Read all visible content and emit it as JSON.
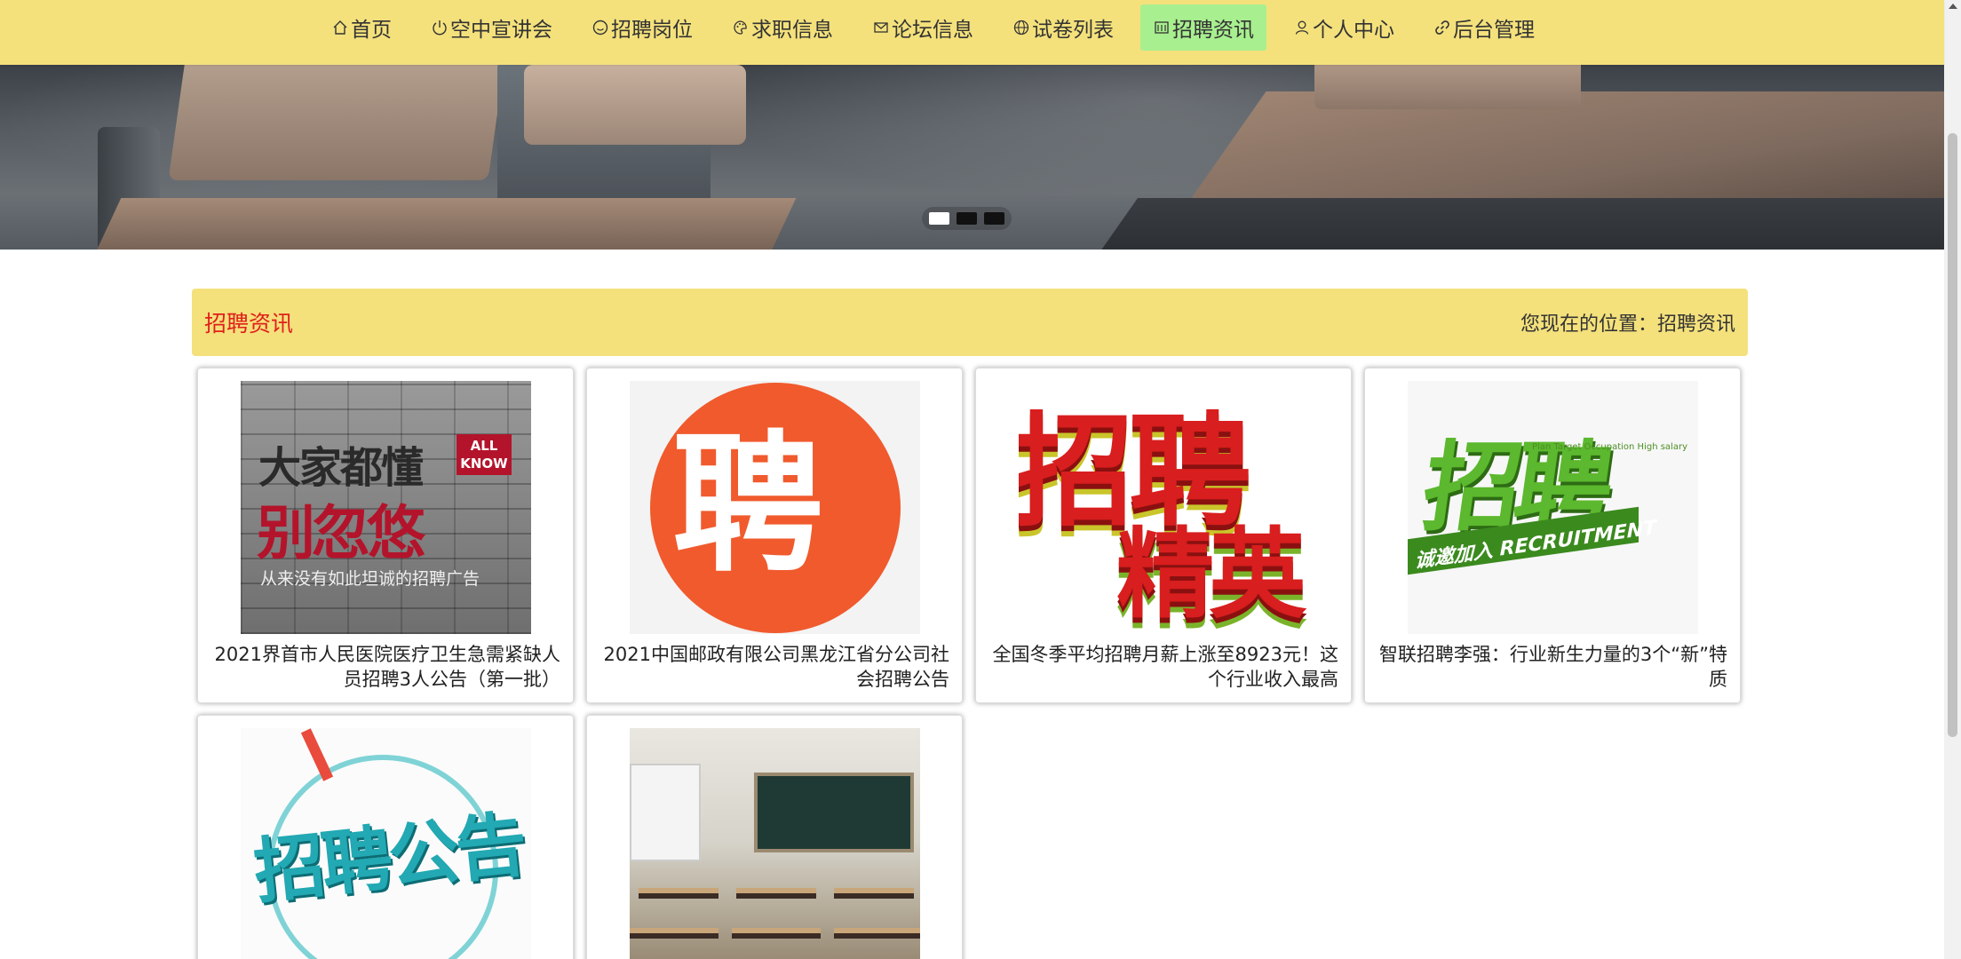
{
  "nav": {
    "items": [
      {
        "label": "首页",
        "icon": "home-icon",
        "active": false
      },
      {
        "label": "空中宣讲会",
        "icon": "power-icon",
        "active": false
      },
      {
        "label": "招聘岗位",
        "icon": "smile-icon",
        "active": false
      },
      {
        "label": "求职信息",
        "icon": "palette-icon",
        "active": false
      },
      {
        "label": "论坛信息",
        "icon": "mail-icon",
        "active": false
      },
      {
        "label": "试卷列表",
        "icon": "globe-icon",
        "active": false
      },
      {
        "label": "招聘资讯",
        "icon": "newspaper-icon",
        "active": true
      },
      {
        "label": "个人中心",
        "icon": "user-icon",
        "active": false
      },
      {
        "label": "后台管理",
        "icon": "link-icon",
        "active": false
      }
    ]
  },
  "banner": {
    "slide_count": 3,
    "active_slide": 1
  },
  "section": {
    "title": "招聘资讯",
    "breadcrumb_prefix": "您现在的位置：",
    "breadcrumb_current": "招聘资讯"
  },
  "thumb_text": {
    "t1_line1": "大家都懂",
    "t1_badge": "ALL KNOW",
    "t1_line2": "别忽悠",
    "t1_line3": "从来没有如此坦诚的招聘广告",
    "t2_glyph": "聘",
    "t3_word1": "招聘",
    "t3_word2": "精英",
    "t4_word": "招聘",
    "t4_ribbon": "诚邀加入 RECRUITMENT",
    "t4_side": "Plan Target Occupation High salary",
    "t5_word": "招聘公告"
  },
  "articles": [
    {
      "title": "2021界首市人民医院医疗卫生急需紧缺人员招聘3人公告（第一批）"
    },
    {
      "title": "2021中国邮政有限公司黑龙江省分公司社会招聘公告"
    },
    {
      "title": "全国冬季平均招聘月薪上涨至8923元！这个行业收入最高"
    },
    {
      "title": "智联招聘李强：行业新生力量的3个“新”特质"
    },
    {
      "title": ""
    },
    {
      "title": ""
    }
  ],
  "colors": {
    "nav_bg": "#f4e17c",
    "nav_active": "#a8ef8f",
    "section_title": "#e0201b"
  }
}
